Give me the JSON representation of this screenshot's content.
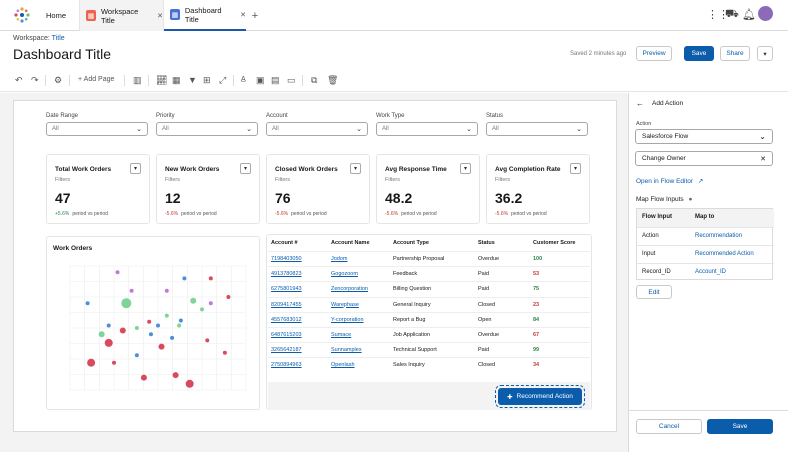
{
  "tabs": [
    {
      "label": "Home"
    },
    {
      "label": "Workspace Title",
      "icon": "workspace-icon",
      "color": "#f0624d"
    },
    {
      "label": "Dashboard Title",
      "icon": "dashboard-icon",
      "color": "#4a6fd6"
    }
  ],
  "header": {
    "breadcrumb_prefix": "Workspace:",
    "breadcrumb_link": "Title",
    "title": "Dashboard Title",
    "saved": "Saved 2 minutes ago",
    "preview": "Preview",
    "save": "Save",
    "share": "Share"
  },
  "toolbar": {
    "add_page": "Add Page"
  },
  "filters": [
    {
      "label": "Date Range",
      "value": "All"
    },
    {
      "label": "Priority",
      "value": "All"
    },
    {
      "label": "Account",
      "value": "All"
    },
    {
      "label": "Work Type",
      "value": "All"
    },
    {
      "label": "Status",
      "value": "All"
    }
  ],
  "kpis": [
    {
      "title": "Total Work Orders",
      "filters": "Filters",
      "value": "47",
      "change": "+5.6%",
      "positive": true,
      "period": "period vs period"
    },
    {
      "title": "New Work Orders",
      "filters": "Filters",
      "value": "12",
      "change": "-5.6%",
      "positive": false,
      "period": "period vs period"
    },
    {
      "title": "Closed Work Orders",
      "filters": "Filters",
      "value": "76",
      "change": "-5.6%",
      "positive": false,
      "period": "period vs period"
    },
    {
      "title": "Avg Response Time",
      "filters": "Filters",
      "value": "48.2",
      "change": "-5.6%",
      "positive": false,
      "period": "period vs period"
    },
    {
      "title": "Avg Completion Rate",
      "filters": "Filters",
      "value": "36.2",
      "change": "-5.6%",
      "positive": false,
      "period": "period vs period"
    }
  ],
  "chart": {
    "title": "Work Orders",
    "points": [
      {
        "x": 0.68,
        "y": 0.95,
        "r": 4,
        "c": "#d94a5e"
      },
      {
        "x": 0.6,
        "y": 0.88,
        "r": 3,
        "c": "#d94a5e"
      },
      {
        "x": 0.42,
        "y": 0.9,
        "r": 3,
        "c": "#d94a5e"
      },
      {
        "x": 0.12,
        "y": 0.78,
        "r": 4,
        "c": "#d94a5e"
      },
      {
        "x": 0.22,
        "y": 0.62,
        "r": 4,
        "c": "#d94a5e"
      },
      {
        "x": 0.3,
        "y": 0.52,
        "r": 3,
        "c": "#d94a5e"
      },
      {
        "x": 0.52,
        "y": 0.65,
        "r": 3,
        "c": "#d94a5e"
      },
      {
        "x": 0.25,
        "y": 0.78,
        "r": 2,
        "c": "#d94a5e"
      },
      {
        "x": 0.9,
        "y": 0.25,
        "r": 2,
        "c": "#d94a5e"
      },
      {
        "x": 0.8,
        "y": 0.1,
        "r": 2,
        "c": "#d94a5e"
      },
      {
        "x": 0.78,
        "y": 0.6,
        "r": 2,
        "c": "#d94a5e"
      },
      {
        "x": 0.45,
        "y": 0.45,
        "r": 2,
        "c": "#d94a5e"
      },
      {
        "x": 0.88,
        "y": 0.7,
        "r": 2,
        "c": "#d94a5e"
      },
      {
        "x": 0.32,
        "y": 0.3,
        "r": 5,
        "c": "#7fd49a"
      },
      {
        "x": 0.18,
        "y": 0.55,
        "r": 3,
        "c": "#7fd49a"
      },
      {
        "x": 0.7,
        "y": 0.28,
        "r": 3,
        "c": "#7fd49a"
      },
      {
        "x": 0.75,
        "y": 0.35,
        "r": 2,
        "c": "#7fd49a"
      },
      {
        "x": 0.38,
        "y": 0.5,
        "r": 2,
        "c": "#7fd49a"
      },
      {
        "x": 0.55,
        "y": 0.4,
        "r": 2,
        "c": "#7fd49a"
      },
      {
        "x": 0.62,
        "y": 0.48,
        "r": 2,
        "c": "#7fd49a"
      },
      {
        "x": 0.1,
        "y": 0.3,
        "r": 2,
        "c": "#4c8fd6"
      },
      {
        "x": 0.22,
        "y": 0.48,
        "r": 2,
        "c": "#4c8fd6"
      },
      {
        "x": 0.38,
        "y": 0.72,
        "r": 2,
        "c": "#4c8fd6"
      },
      {
        "x": 0.46,
        "y": 0.55,
        "r": 2,
        "c": "#4c8fd6"
      },
      {
        "x": 0.5,
        "y": 0.48,
        "r": 2,
        "c": "#4c8fd6"
      },
      {
        "x": 0.63,
        "y": 0.44,
        "r": 2,
        "c": "#4c8fd6"
      },
      {
        "x": 0.65,
        "y": 0.1,
        "r": 2,
        "c": "#4c8fd6"
      },
      {
        "x": 0.58,
        "y": 0.58,
        "r": 2,
        "c": "#4c8fd6"
      },
      {
        "x": 0.35,
        "y": 0.2,
        "r": 2,
        "c": "#c079d6"
      },
      {
        "x": 0.55,
        "y": 0.2,
        "r": 2,
        "c": "#c079d6"
      },
      {
        "x": 0.27,
        "y": 0.05,
        "r": 2,
        "c": "#c079d6"
      },
      {
        "x": 0.8,
        "y": 0.3,
        "r": 2,
        "c": "#c079d6"
      }
    ]
  },
  "table": {
    "headers": [
      "Account #",
      "Account Name",
      "Account Type",
      "Status",
      "Customer Score"
    ],
    "rows": [
      {
        "account": "7198403050",
        "name": "Jodom",
        "type": "Partnership Proposal",
        "status": "Overdue",
        "score": "100",
        "color": "#2e844a"
      },
      {
        "account": "4913780823",
        "name": "Gogozoom",
        "type": "Feedback",
        "status": "Paid",
        "score": "53",
        "color": "#c23934"
      },
      {
        "account": "6275801943",
        "name": "Zencorporation",
        "type": "Billing Question",
        "status": "Paid",
        "score": "75",
        "color": "#2e844a"
      },
      {
        "account": "8209417455",
        "name": "Warephase",
        "type": "General Inquiry",
        "status": "Closed",
        "score": "23",
        "color": "#c23934"
      },
      {
        "account": "4557683012",
        "name": "Y-corporation",
        "type": "Report a Bug",
        "status": "Open",
        "score": "84",
        "color": "#2e844a"
      },
      {
        "account": "6487615203",
        "name": "Sumace",
        "type": "Job Application",
        "status": "Overdue",
        "score": "67",
        "color": "#c23934"
      },
      {
        "account": "3265642187",
        "name": "Sunnamplex",
        "type": "Technical Support",
        "status": "Paid",
        "score": "99",
        "color": "#2e844a"
      },
      {
        "account": "2750894963",
        "name": "Openlash",
        "type": "Sales Inquiry",
        "status": "Closed",
        "score": "34",
        "color": "#c23934"
      }
    ],
    "recommend": "Recommend Action"
  },
  "panel": {
    "title": "Add Action",
    "action_label": "Action",
    "action_value": "Salesforce Flow",
    "flow_value": "Change Owner",
    "open_flow": "Open in Flow Editor",
    "map_inputs": "Map Flow Inputs",
    "col_input": "Flow Input",
    "col_map": "Map to",
    "rows": [
      {
        "input": "Action",
        "map": "Recommendation"
      },
      {
        "input": "Input",
        "map": "Recommended Action"
      },
      {
        "input": "Record_ID",
        "map": "Account_ID"
      }
    ],
    "edit": "Edit",
    "cancel": "Cancel",
    "save": "Save"
  }
}
